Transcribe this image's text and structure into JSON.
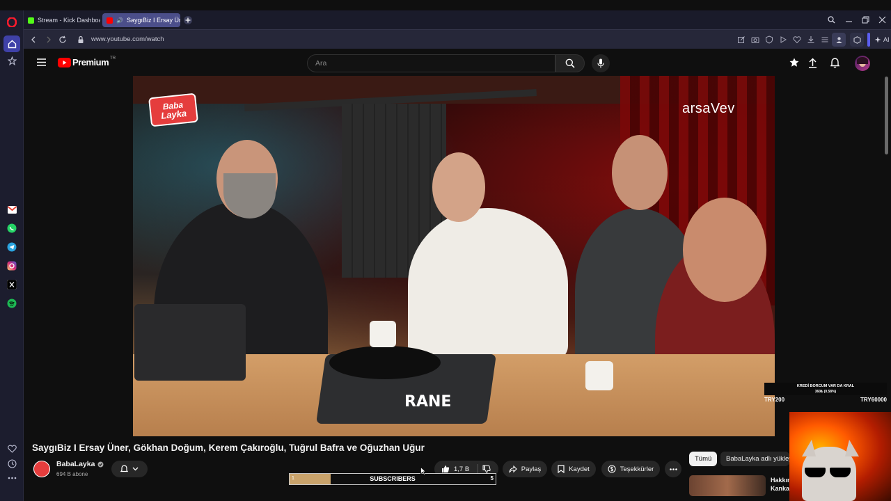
{
  "browser": {
    "tabs": [
      {
        "label": "Stream - Kick Dashboard",
        "active": false,
        "favicon_color": "#53fc18"
      },
      {
        "label": "SaygıBiz I Ersay Üner,",
        "active": true,
        "favicon_color": "#ff0000"
      }
    ],
    "url": "www.youtube.com/watch",
    "ai_label": "AI"
  },
  "youtube": {
    "logo_text": "Premium",
    "logo_region": "TR",
    "search_placeholder": "Ara",
    "video_title": "SaygıBiz I Ersay Üner, Gökhan Doğum, Kerem Çakıroğlu, Tuğrul Bafra ve Oğuzhan Uğur",
    "channel_name": "BabaLayka",
    "subscribers": "694 B abone",
    "likes": "1,7 B",
    "share_label": "Paylaş",
    "save_label": "Kaydet",
    "thanks_label": "Teşekkürler",
    "chips": [
      "Tümü",
      "BabaLayka adlı yükley"
    ],
    "related_title": "Hakkın Kanka"
  },
  "video_overlay": {
    "logo_top": "Baba",
    "logo_bottom": "Layka",
    "sponsor": "arsaVev",
    "rane": "RANE"
  },
  "stream_overlay": {
    "goal_title": "KREDİ BORCUM VAR DA KRAL",
    "goal_progress": "360₺ (0.58%)",
    "goal_min": "TRY200",
    "goal_max": "TRY60000",
    "sub_label": "SUBSCRIBERS",
    "sub_current": "1",
    "sub_goal": "5",
    "sub_fraction": 0.2
  },
  "colors": {
    "yt_red": "#ff0000",
    "sidebar_bg": "#1c1d2e",
    "active_tab": "#4b4e8a",
    "goal_fill": "#c9a36b"
  }
}
